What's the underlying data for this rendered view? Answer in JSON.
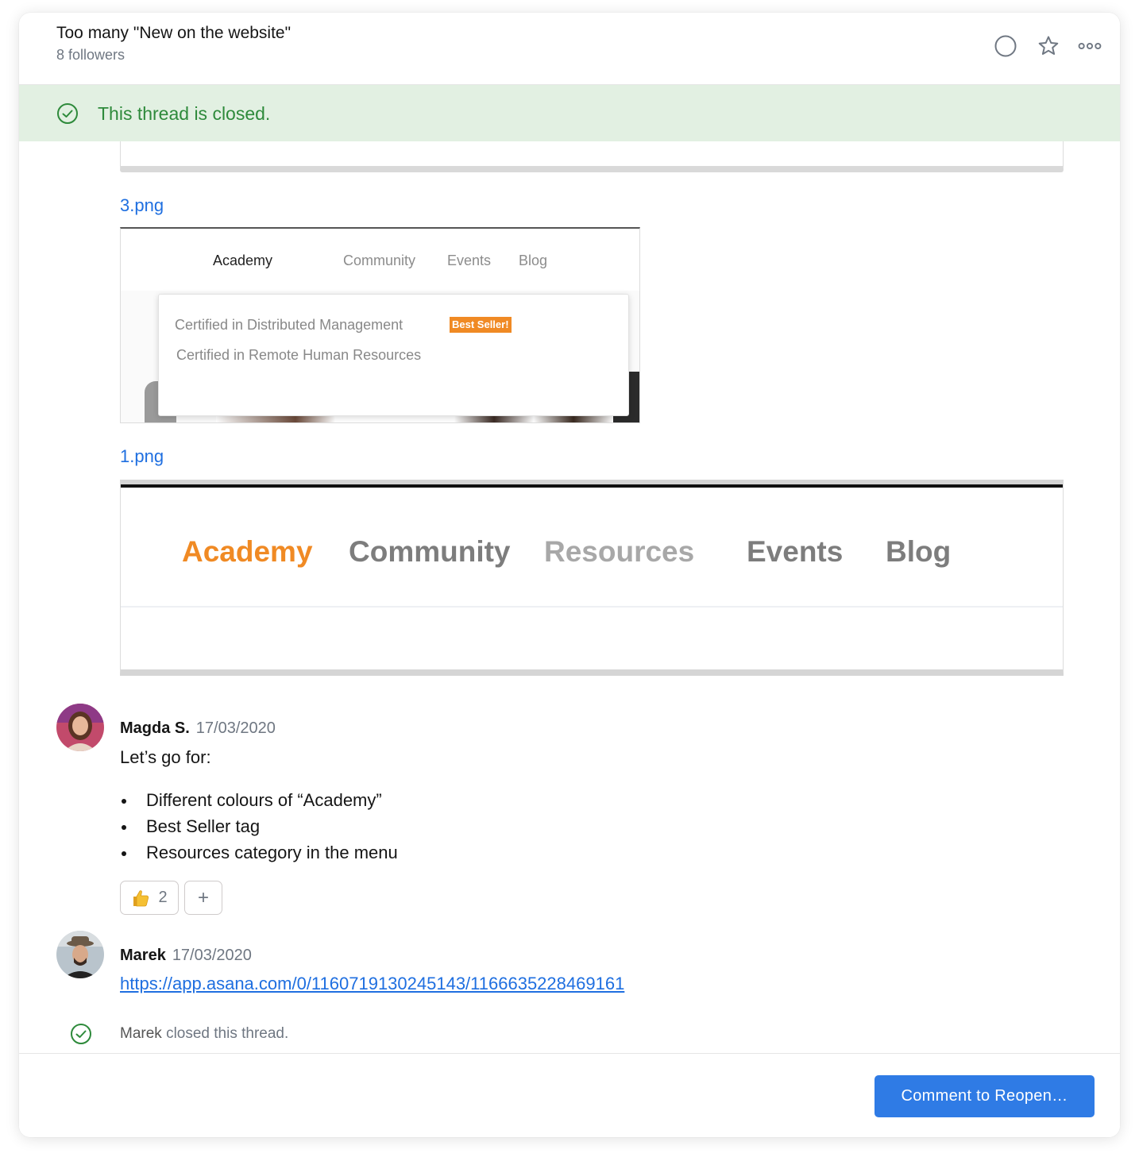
{
  "header": {
    "title": "Too many \"New on the website\"",
    "followers": "8 followers",
    "icons": [
      "complete-circle-icon",
      "star-icon",
      "more-icon"
    ]
  },
  "banner": {
    "text": "This thread is closed.",
    "icon": "check-circle-icon",
    "color": "#2e8a3b",
    "background": "#e2f0e2"
  },
  "attachments": [
    {
      "filename": "3.png",
      "preview": {
        "nav": [
          "Academy",
          "Community",
          "Events",
          "Blog"
        ],
        "dropdown_items": [
          "Certified in Distributed Management",
          "Certified in Remote Human Resources"
        ],
        "badge": "Best Seller!"
      }
    },
    {
      "filename": "1.png",
      "preview": {
        "nav": [
          "Academy",
          "Community",
          "Resources",
          "Events",
          "Blog"
        ],
        "accent": "#f08a24"
      }
    }
  ],
  "comments": [
    {
      "author": "Magda S.",
      "date": "17/03/2020",
      "text": "Let’s go for:",
      "bullets": [
        "Different colours of “Academy”",
        "Best Seller tag",
        "Resources category in the menu"
      ],
      "reactions": {
        "thumbs_up_count": "2",
        "add_label": "+"
      }
    },
    {
      "author": "Marek",
      "date": "17/03/2020",
      "link": "https://app.asana.com/0/1160719130245143/1166635228469161"
    }
  ],
  "system_event": {
    "actor": "Marek",
    "text": " closed this thread."
  },
  "footer": {
    "reopen_button": "Comment to Reopen…",
    "button_color": "#2f7be5"
  }
}
